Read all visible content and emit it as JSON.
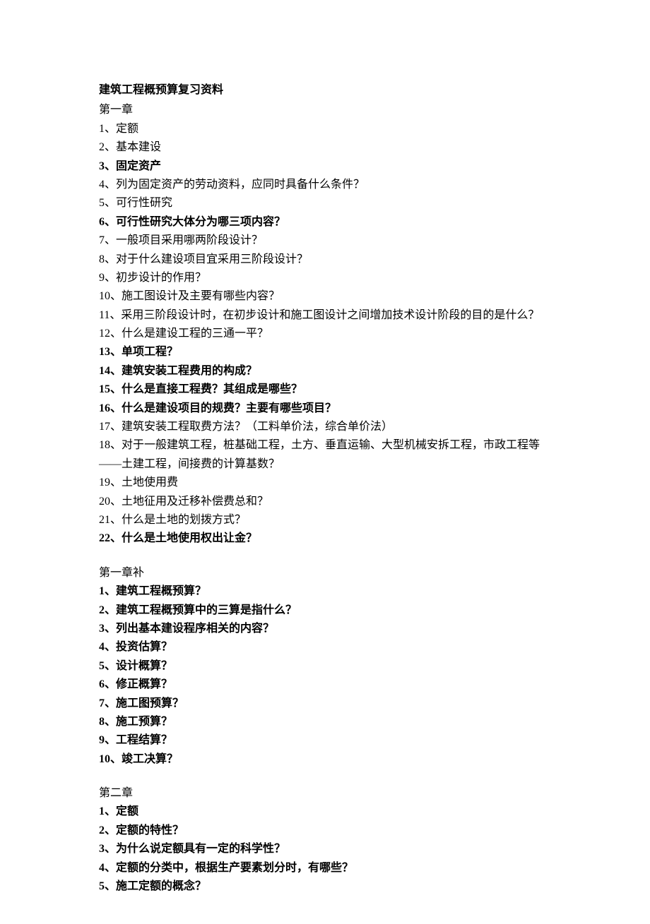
{
  "title": "建筑工程概预算复习资料",
  "sections": [
    {
      "heading": "第一章",
      "spaced": false,
      "items": [
        {
          "text": "1、定额",
          "bold": false,
          "wrap": false
        },
        {
          "text": "2、基本建设",
          "bold": false,
          "wrap": false
        },
        {
          "text": "3、固定资产",
          "bold": true,
          "wrap": false
        },
        {
          "text": "4、列为固定资产的劳动资料，应同时具备什么条件？",
          "bold": false,
          "wrap": false
        },
        {
          "text": "5、可行性研究",
          "bold": false,
          "wrap": false
        },
        {
          "text": "6、可行性研究大体分为哪三项内容？",
          "bold": true,
          "wrap": false
        },
        {
          "text": "7、一般项目采用哪两阶段设计？",
          "bold": false,
          "wrap": false
        },
        {
          "text": "8、对于什么建设项目宜采用三阶段设计？",
          "bold": false,
          "wrap": false
        },
        {
          "text": "9、初步设计的作用？",
          "bold": false,
          "wrap": false
        },
        {
          "text": "10、施工图设计及主要有哪些内容？",
          "bold": false,
          "wrap": false
        },
        {
          "text": "11、采用三阶段设计时，在初步设计和施工图设计之间增加技术设计阶段的目的是什么？",
          "bold": false,
          "wrap": false
        },
        {
          "text": "12、什么是建设工程的三通一平？",
          "bold": false,
          "wrap": false
        },
        {
          "text": "13、单项工程？",
          "bold": true,
          "wrap": false
        },
        {
          "text": "14、建筑安装工程费用的构成？",
          "bold": true,
          "wrap": false
        },
        {
          "text": "15、什么是直接工程费？其组成是哪些？",
          "bold": true,
          "wrap": false
        },
        {
          "text": "16、什么是建设项目的规费？主要有哪些项目？",
          "bold": true,
          "wrap": false
        },
        {
          "text": "17、建筑安装工程取费方法？（工料单价法，综合单价法）",
          "bold": false,
          "wrap": false
        },
        {
          "text": "18、对于一般建筑工程，桩基础工程，土方、垂直运输、大型机械安拆工程，市政工程等——土建工程，间接费的计算基数？",
          "bold": false,
          "wrap": true
        },
        {
          "text": "19、土地使用费",
          "bold": false,
          "wrap": false
        },
        {
          "text": "20、土地征用及迁移补偿费总和？",
          "bold": false,
          "wrap": false
        },
        {
          "text": "21、什么是土地的划拨方式？",
          "bold": false,
          "wrap": false
        },
        {
          "text": "22、什么是土地使用权出让金？",
          "bold": true,
          "wrap": false
        }
      ]
    },
    {
      "heading": "第一章补",
      "spaced": true,
      "items": [
        {
          "text": "1、建筑工程概预算？",
          "bold": true,
          "wrap": false
        },
        {
          "text": "2、建筑工程概预算中的三算是指什么？",
          "bold": true,
          "wrap": false
        },
        {
          "text": "3、列出基本建设程序相关的内容？",
          "bold": true,
          "wrap": false
        },
        {
          "text": "4、投资估算？",
          "bold": true,
          "wrap": false
        },
        {
          "text": "5、设计概算？",
          "bold": true,
          "wrap": false
        },
        {
          "text": "6、修正概算？",
          "bold": true,
          "wrap": false
        },
        {
          "text": "7、施工图预算？",
          "bold": true,
          "wrap": false
        },
        {
          "text": "8、施工预算？",
          "bold": true,
          "wrap": false
        },
        {
          "text": "9、工程结算？",
          "bold": true,
          "wrap": false
        },
        {
          "text": "10、竣工决算？",
          "bold": true,
          "wrap": false
        }
      ]
    },
    {
      "heading": "第二章",
      "spaced": true,
      "items": [
        {
          "text": "1、定额",
          "bold": true,
          "wrap": false
        },
        {
          "text": "2、定额的特性？",
          "bold": true,
          "wrap": false
        },
        {
          "text": "3、为什么说定额具有一定的科学性？",
          "bold": true,
          "wrap": false
        },
        {
          "text": "4、定额的分类中，根据生产要素划分时，有哪些？",
          "bold": true,
          "wrap": false
        },
        {
          "text": "5、施工定额的概念？",
          "bold": true,
          "wrap": false
        }
      ]
    }
  ]
}
